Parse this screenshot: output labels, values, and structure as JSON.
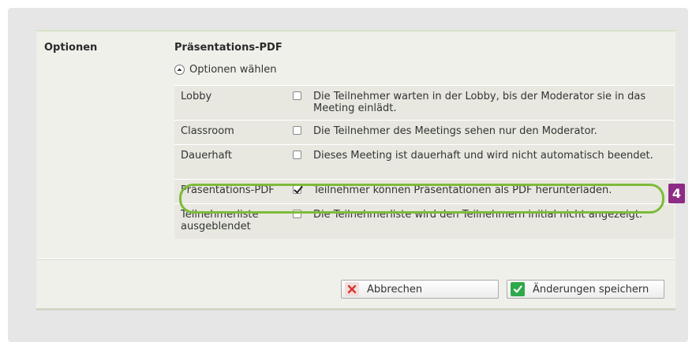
{
  "section": {
    "label": "Optionen",
    "title": "Präsentations-PDF",
    "toggle_label": "Optionen wählen"
  },
  "options": [
    {
      "name": "Lobby",
      "checked": false,
      "description": "Die Teilnehmer warten in der Lobby, bis der Moderator sie in das Meeting einlädt."
    },
    {
      "name": "Classroom",
      "checked": false,
      "description": "Die Teilnehmer des Meetings sehen nur den Moderator."
    },
    {
      "name": "Dauerhaft",
      "checked": false,
      "description": "Dieses Meeting ist dauerhaft und wird nicht automatisch beendet."
    },
    {
      "name": "Präsentations-PDF",
      "checked": true,
      "description": "Teilnehmer können Präsentationen als PDF herunterladen."
    },
    {
      "name": "Teilnehmerliste ausgeblendet",
      "checked": false,
      "description": "Die Teilnehmerliste wird den Teilnehmern initial nicht angezeigt."
    }
  ],
  "callout": {
    "number": "4",
    "color": "#8e2b86",
    "highlight_color": "#7dbb3a"
  },
  "buttons": {
    "cancel": "Abbrechen",
    "save": "Änderungen speichern"
  },
  "icons": {
    "toggle": "chevron-up-circle-icon",
    "cancel": "x-icon",
    "save": "checkmark-icon"
  }
}
